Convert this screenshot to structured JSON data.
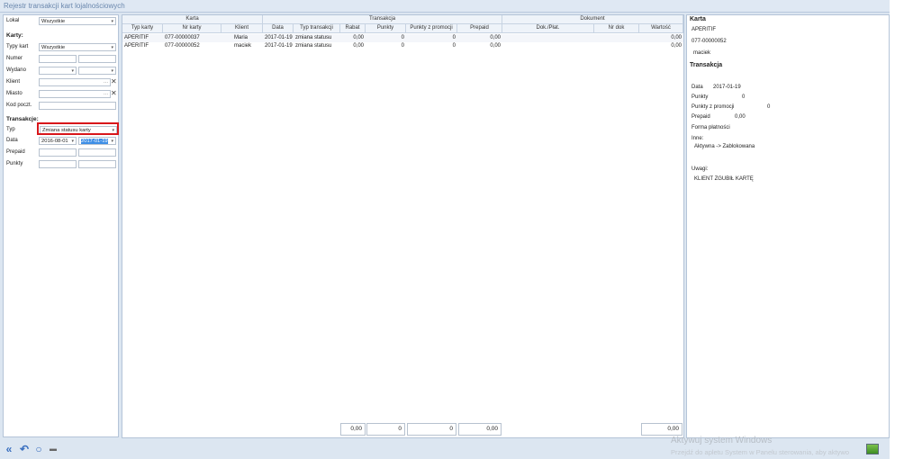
{
  "title": "Rejestr transakcji kart lojalnościowych",
  "filters": {
    "lokal_label": "Lokal",
    "lokal_value": "Wszystkie",
    "karty_section": "Karty:",
    "typy_kart_label": "Typy kart",
    "typy_kart_value": "Wszystkie",
    "numer_label": "Numer",
    "wydano_label": "Wydano",
    "klient_label": "Klient",
    "miasto_label": "Miasto",
    "kod_label": "Kod poczt.",
    "transakcje_section": "Transakcje:",
    "typ_label": "Typ",
    "typ_value": "Zmiana statusu karty",
    "data_label": "Data",
    "data_from": "2016-08-01",
    "data_to": "2017-01-19",
    "prepaid_label": "Prepaid",
    "punkty_label": "Punkty"
  },
  "grid": {
    "groups": {
      "karta": "Karta",
      "transakcja": "Transakcja",
      "dokument": "Dokument"
    },
    "columns": {
      "typ_karty": "Typ karty",
      "nr_karty": "Nr karty",
      "klient": "Klient",
      "data": "Data",
      "typ_transakcji": "Typ transakcji",
      "rabat": "Rabat",
      "punkty": "Punkty",
      "punkty_z_promocji": "Punkty z promocji",
      "prepaid": "Prepaid",
      "dok_plat": "Dok./Płat.",
      "nr_dok": "Nr dok",
      "wartosc": "Wartość"
    },
    "rows": [
      {
        "typ_karty": "APERITIF",
        "nr_karty": "077-00000037",
        "klient": "Maria",
        "data": "2017-01-19",
        "typ_transakcji": "zmiana statusu",
        "rabat": "0,00",
        "punkty": "0",
        "punkty_z_promocji": "0",
        "prepaid": "0,00",
        "dok_plat": "",
        "nr_dok": "",
        "wartosc": "0,00"
      },
      {
        "typ_karty": "APERITIF",
        "nr_karty": "077-00000052",
        "klient": "maciek",
        "data": "2017-01-19",
        "typ_transakcji": "zmiana statusu",
        "rabat": "0,00",
        "punkty": "0",
        "punkty_z_promocji": "0",
        "prepaid": "0,00",
        "dok_plat": "",
        "nr_dok": "",
        "wartosc": "0,00"
      }
    ],
    "totals": {
      "rabat": "0,00",
      "punkty": "0",
      "punkty_z_promocji": "0",
      "prepaid": "0,00",
      "wartosc": "0,00"
    }
  },
  "detail": {
    "karta_heading": "Karta",
    "card_type": "APERITIF",
    "card_number": "077-00000052",
    "client": "maciek",
    "transakcja_heading": "Transakcja",
    "data_label": "Data",
    "data_value": "2017-01-19",
    "punkty_label": "Punkty",
    "punkty_value": "0",
    "punkty_promo_label": "Punkty z promocji",
    "punkty_promo_value": "0",
    "prepaid_label": "Prepaid",
    "prepaid_value": "0,00",
    "forma_label": "Forma płatności",
    "inne_label": "Inne:",
    "inne_value": "Aktywna -> Zablokowana",
    "uwagi_label": "Uwagi:",
    "uwagi_value": "KLIENT ZGUBIŁ KARTĘ"
  },
  "toolbar": {
    "back_icon": "«",
    "undo_icon": "↶",
    "refresh_icon": "○",
    "print_icon": "▬"
  },
  "watermark": {
    "line1": "Aktywuj system Windows",
    "line2": "Przejdź do apletu System w Panelu sterowania, aby aktywo"
  }
}
